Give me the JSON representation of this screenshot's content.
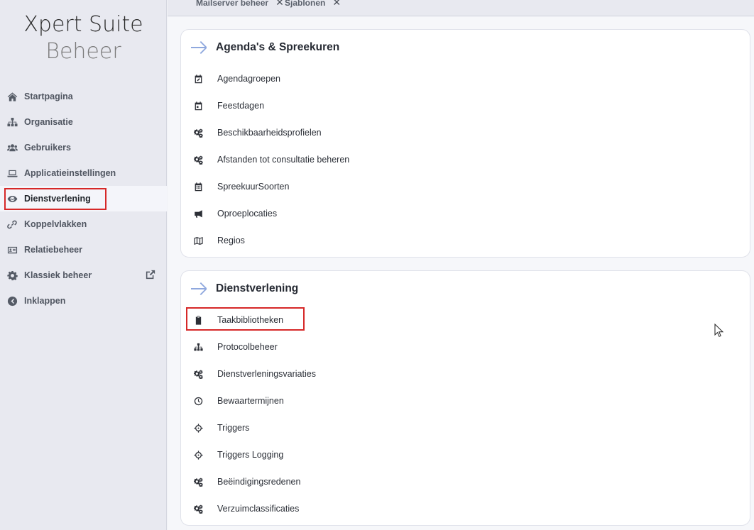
{
  "brand": {
    "line1": "Xpert Suite",
    "line2": "Beheer"
  },
  "sidebar": {
    "items": [
      {
        "label": "Startpagina",
        "icon": "home-icon"
      },
      {
        "label": "Organisatie",
        "icon": "sitemap-icon"
      },
      {
        "label": "Gebruikers",
        "icon": "users-icon"
      },
      {
        "label": "Applicatieinstellingen",
        "icon": "laptop-icon"
      },
      {
        "label": "Dienstverlening",
        "icon": "handshake-icon",
        "active": true
      },
      {
        "label": "Koppelvlakken",
        "icon": "link-icon"
      },
      {
        "label": "Relatiebeheer",
        "icon": "id-card-icon"
      },
      {
        "label": "Klassiek beheer",
        "icon": "gear-icon",
        "external": "external-link-icon"
      },
      {
        "label": "Inklappen",
        "icon": "chevron-left-circle-icon"
      }
    ]
  },
  "tabs": [
    {
      "label": "Mailserver beheer",
      "close": "✕"
    },
    {
      "label": "Sjablonen",
      "close": "✕"
    }
  ],
  "sections": [
    {
      "title": "Agenda's & Spreekuren",
      "items": [
        {
          "label": "Agendagroepen",
          "icon": "calendar-edit-icon"
        },
        {
          "label": "Feestdagen",
          "icon": "calendar-day-icon"
        },
        {
          "label": "Beschikbaarheidsprofielen",
          "icon": "cogs-icon"
        },
        {
          "label": "Afstanden tot consultatie beheren",
          "icon": "cogs-icon"
        },
        {
          "label": "SpreekuurSoorten",
          "icon": "calendar-grid-icon"
        },
        {
          "label": "Oproeplocaties",
          "icon": "megaphone-icon"
        },
        {
          "label": "Regios",
          "icon": "map-icon"
        }
      ]
    },
    {
      "title": "Dienstverlening",
      "items": [
        {
          "label": "Taakbibliotheken",
          "icon": "clipboard-icon"
        },
        {
          "label": "Protocolbeheer",
          "icon": "sitemap-icon"
        },
        {
          "label": "Dienstverleningsvariaties",
          "icon": "cogs-icon"
        },
        {
          "label": "Bewaartermijnen",
          "icon": "clock-icon"
        },
        {
          "label": "Triggers",
          "icon": "crosshairs-icon"
        },
        {
          "label": "Triggers Logging",
          "icon": "crosshairs-icon"
        },
        {
          "label": "Beëindigingsredenen",
          "icon": "cogs-icon"
        },
        {
          "label": "Verzuimclassificaties",
          "icon": "cogs-icon"
        }
      ]
    }
  ],
  "colors": {
    "highlight": "#d62828",
    "accent_arrow": "#8fa8de",
    "active_bg": "#f4f5fa"
  }
}
